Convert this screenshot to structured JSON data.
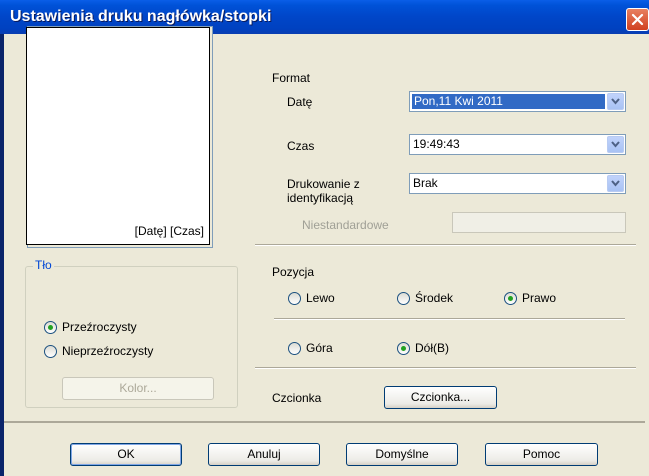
{
  "window": {
    "title": "Ustawienia druku nagłówka/stopki"
  },
  "preview": {
    "text": "[Datę] [Czas]"
  },
  "background": {
    "group_label": "Tło",
    "options": [
      {
        "label": "Przeźroczysty",
        "checked": true
      },
      {
        "label": "Nieprzeźroczysty",
        "checked": false
      }
    ],
    "color_button": "Kolor..."
  },
  "format": {
    "label": "Format",
    "date_label": "Datę",
    "date_value": "Pon,11 Kwi 2011",
    "time_label": "Czas",
    "time_value": "19:49:43",
    "id_label_line1": "Drukowanie z",
    "id_label_line2": "identyfikacją",
    "id_value": "Brak",
    "custom_label": "Niestandardowe",
    "custom_value": ""
  },
  "position": {
    "label": "Pozycja",
    "horizontal": [
      {
        "label": "Lewo",
        "checked": false
      },
      {
        "label": "Środek",
        "checked": false
      },
      {
        "label": "Prawo",
        "checked": true
      }
    ],
    "vertical": [
      {
        "label": "Góra",
        "checked": false
      },
      {
        "label": "Dół(B)",
        "checked": true
      }
    ]
  },
  "font": {
    "label": "Czcionka",
    "button": "Czcionka..."
  },
  "buttons": {
    "ok": "OK",
    "cancel": "Anuluj",
    "default": "Domyślne",
    "help": "Pomoc"
  }
}
